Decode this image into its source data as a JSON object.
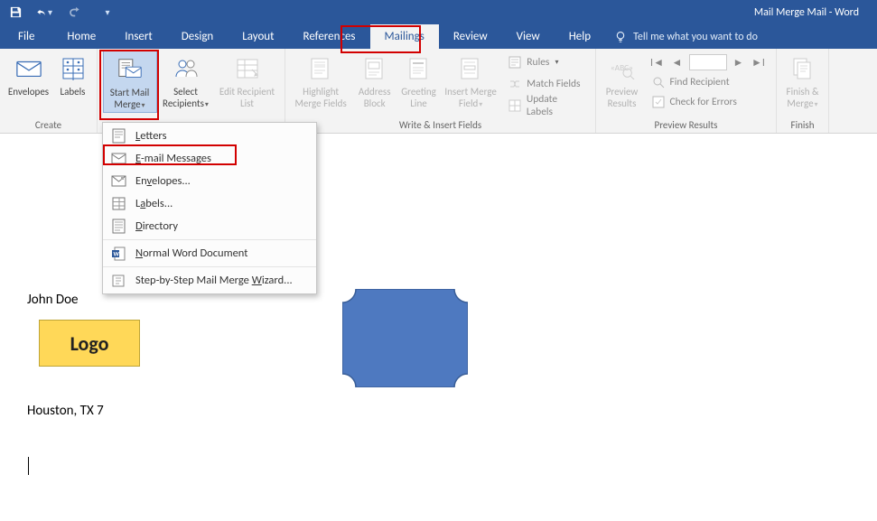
{
  "title": "Mail Merge Mail  -  Word",
  "tabs": {
    "file": "File",
    "home": "Home",
    "insert": "Insert",
    "design": "Design",
    "layout": "Layout",
    "references": "References",
    "mailings": "Mailings",
    "review": "Review",
    "view": "View",
    "help": "Help"
  },
  "tell_me": "Tell me what you want to do",
  "ribbon": {
    "create": {
      "envelopes": "Envelopes",
      "labels": "Labels",
      "group": "Create"
    },
    "start": {
      "start_mail": "Start Mail Merge",
      "select_rec": "Select Recipients",
      "edit_list": "Edit Recipient List"
    },
    "fields": {
      "highlight": "Highlight Merge Fields",
      "address": "Address Block",
      "greeting": "Greeting Line",
      "insert_field": "Insert Merge Field",
      "rules": "Rules",
      "match": "Match Fields",
      "update": "Update Labels",
      "group": "Write & Insert Fields"
    },
    "preview": {
      "preview": "Preview Results",
      "find": "Find Recipient",
      "errors": "Check for Errors",
      "group": "Preview Results"
    },
    "finish": {
      "finish": "Finish & Merge",
      "group": "Finish"
    }
  },
  "menu": {
    "letters": "Letters",
    "email": "E-mail Messages",
    "envelopes": "Envelopes...",
    "labels": "Labels...",
    "directory": "Directory",
    "normal": "Normal Word Document",
    "wizard": "Step-by-Step Mail Merge Wizard..."
  },
  "doc": {
    "john": "John Doe",
    "logo": "Logo",
    "houston": "Houston, TX 7"
  }
}
